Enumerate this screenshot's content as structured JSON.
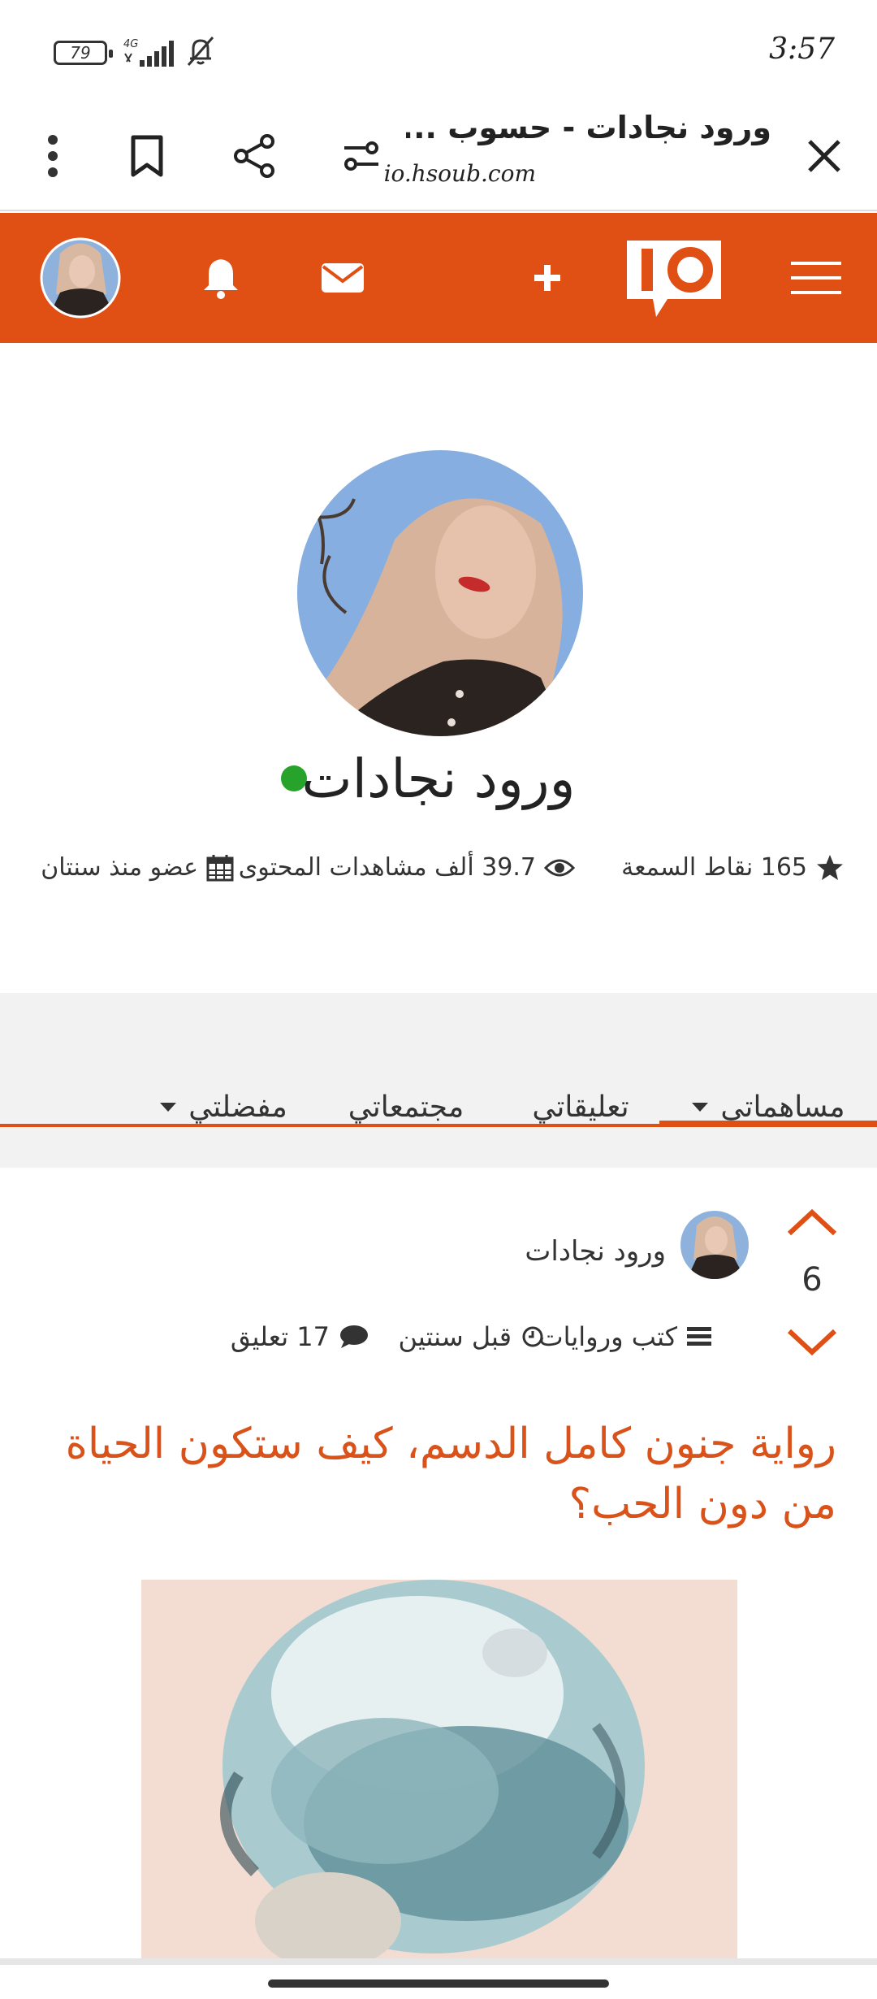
{
  "status_bar": {
    "time": "3:57",
    "battery": "79",
    "network": "4G"
  },
  "browser": {
    "page_title": "ورود نجادات - حسوب ...",
    "url": "io.hsoub.com",
    "close_icon": "close-icon",
    "settings_icon": "sliders-icon",
    "share_icon": "share-icon",
    "bookmark_icon": "bookmark-icon",
    "menu_icon": "more-vertical-icon"
  },
  "header": {
    "bg_color": "#e04f13",
    "icons": [
      "hamburger-icon",
      "io-logo",
      "plus-icon",
      "envelope-icon",
      "bell-icon",
      "avatar"
    ]
  },
  "profile": {
    "name": "ورود نجادات",
    "online_color": "#27a32b",
    "stats": {
      "reputation": "165 نقاط السمعة",
      "views": "39.7 ألف مشاهدات المحتوى",
      "member_since": "عضو منذ سنتان"
    }
  },
  "tabs": {
    "items": [
      {
        "label": "مساهماتي",
        "active": true,
        "dropdown": true
      },
      {
        "label": "تعليقاتي",
        "active": false,
        "dropdown": false
      },
      {
        "label": "مجتمعاتي",
        "active": false,
        "dropdown": false
      },
      {
        "label": "مفضلتي",
        "active": false,
        "dropdown": true
      }
    ]
  },
  "post": {
    "votes": "6",
    "author": "ورود نجادات",
    "category": "كتب وروايات",
    "time": "قبل سنتين",
    "comments": "17 تعليق",
    "title": "رواية جنون كامل الدسم، كيف ستكون الحياة من دون الحب؟",
    "accent_color": "#d9521a"
  }
}
